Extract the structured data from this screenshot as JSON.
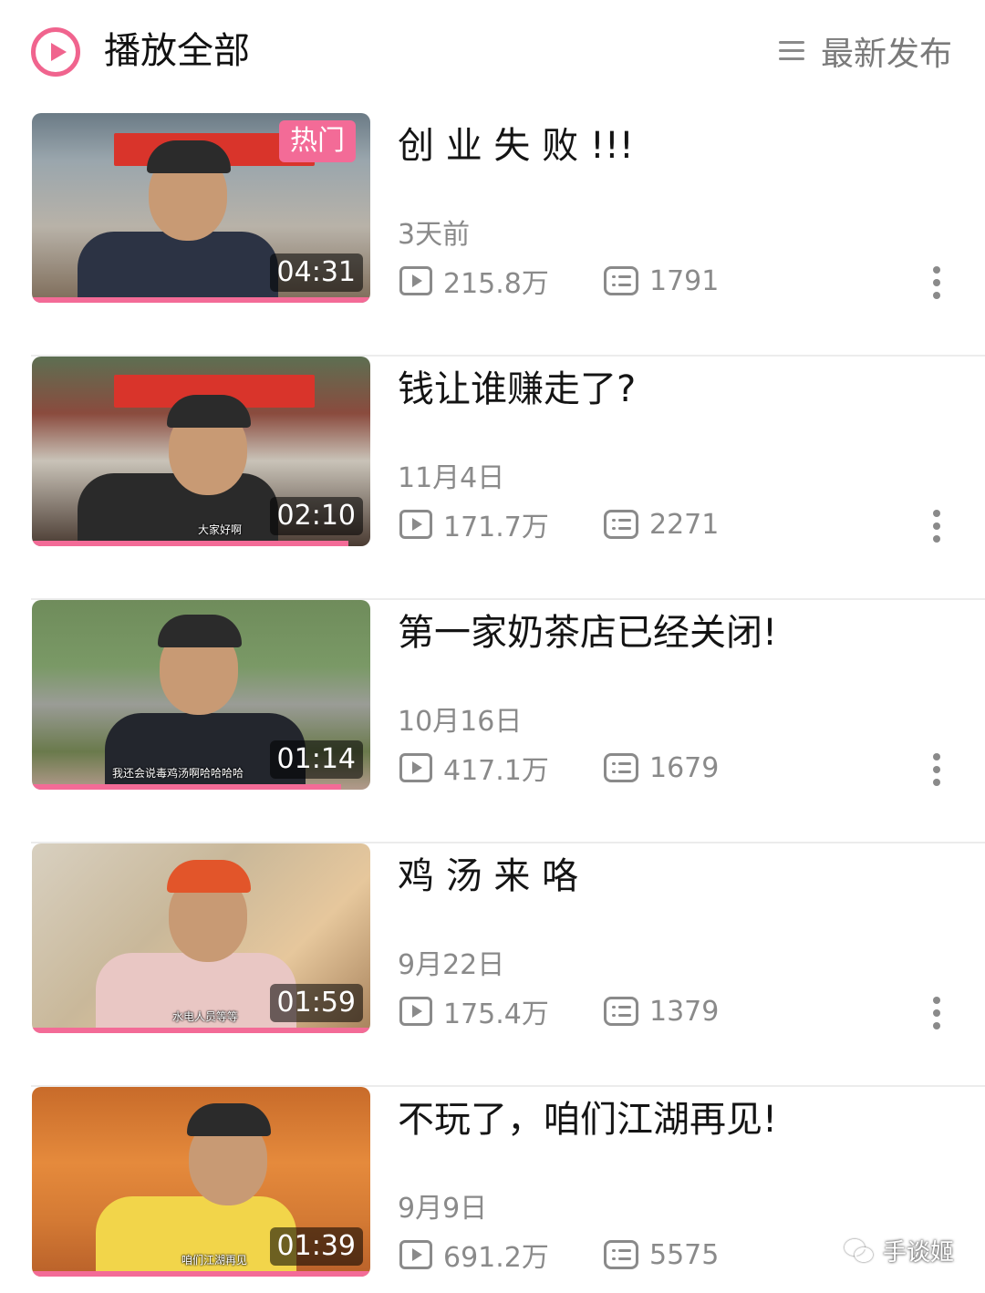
{
  "header": {
    "play_all_label": "播放全部",
    "sort_label": "最新发布"
  },
  "videos": [
    {
      "title": "创 业 失 败 !!!",
      "date": "3天前",
      "plays": "215.8万",
      "comments": "1791",
      "duration": "04:31",
      "badge": "热门",
      "subtitle": ""
    },
    {
      "title": "钱让谁赚走了?",
      "date": "11月4日",
      "plays": "171.7万",
      "comments": "2271",
      "duration": "02:10",
      "subtitle": "大家好啊"
    },
    {
      "title": "第一家奶茶店已经关闭!",
      "date": "10月16日",
      "plays": "417.1万",
      "comments": "1679",
      "duration": "01:14",
      "subtitle": "我还会说毒鸡汤啊哈哈哈哈"
    },
    {
      "title": "鸡 汤 来 咯",
      "date": "9月22日",
      "plays": "175.4万",
      "comments": "1379",
      "duration": "01:59",
      "subtitle": "水电人员等等"
    },
    {
      "title": "不玩了，咱们江湖再见!",
      "date": "9月9日",
      "plays": "691.2万",
      "comments": "5575",
      "duration": "01:39",
      "subtitle": "咱们江湖再见"
    }
  ],
  "watermark": {
    "text": "手谈姬"
  },
  "colors": {
    "accent": "#f36b97",
    "muted": "#8a8a8a"
  }
}
